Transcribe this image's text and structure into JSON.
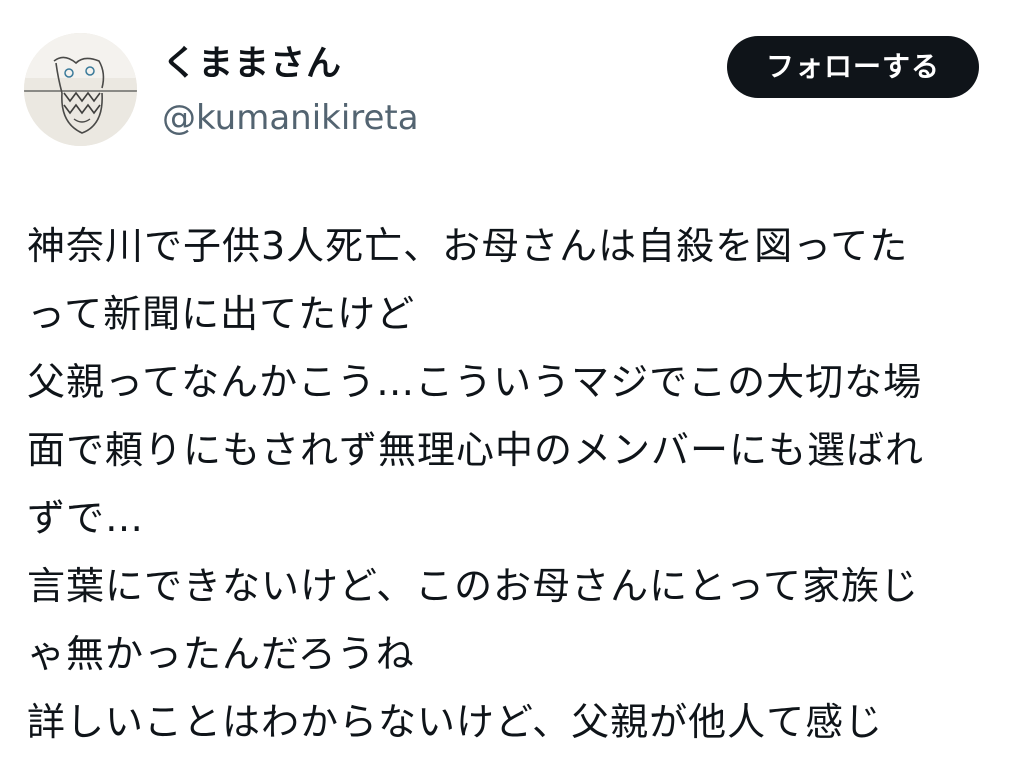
{
  "profile": {
    "display_name": "くままさん",
    "handle": "@kumanikireta",
    "avatar_icon": "hand-drawn-doodle-avatar"
  },
  "follow_button": {
    "label": "フォローする"
  },
  "tweet": {
    "lines": [
      "神奈川で子供3人死亡、お母さんは自殺を図ってた",
      "って新聞に出てたけど",
      "父親ってなんかこう…こういうマジでこの大切な場",
      "面で頼りにもされず無理心中のメンバーにも選ばれ",
      "ずで…",
      "言葉にできないけど、このお母さんにとって家族じ",
      "ゃ無かったんだろうね",
      "詳しいことはわからないけど、父親が他人て感じ"
    ]
  }
}
